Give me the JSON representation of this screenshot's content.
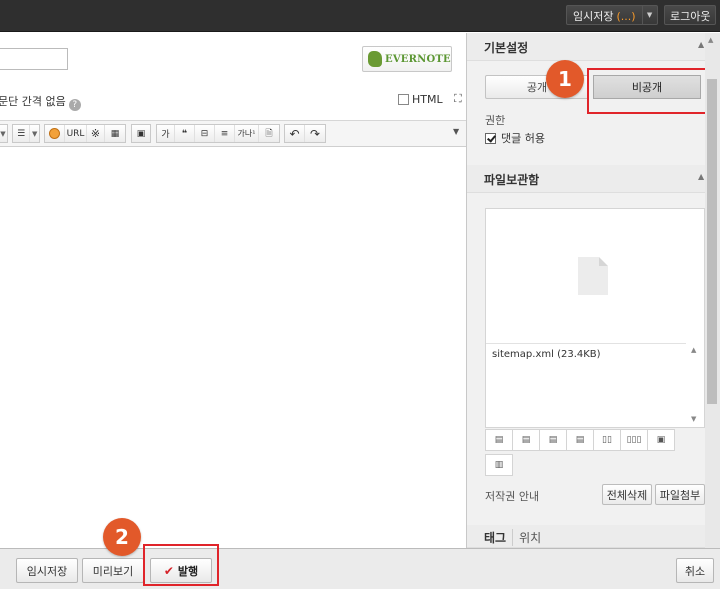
{
  "header": {
    "temp_save_label": "임시저장",
    "temp_save_count": "(...)",
    "logout_label": "로그아웃"
  },
  "editor": {
    "evernote_label": "EVERNOTE",
    "paragraph_option": "문단 간격 없음",
    "html_label": "HTML"
  },
  "toolbar": {
    "url_label": "URL",
    "quote_label": "❝",
    "ga_label": "가",
    "ga1_label": "가나¹"
  },
  "sidebar": {
    "basic_settings": {
      "title": "기본설정",
      "public_label": "공개",
      "private_label": "비공개",
      "permission_label": "권한",
      "allow_comments_label": "댓글 허용"
    },
    "file_storage": {
      "title": "파일보관함",
      "files": [
        "sitemap.xml (23.4KB)"
      ],
      "copyright_label": "저작권 안내",
      "delete_all_label": "전체삭제",
      "attach_label": "파일첨부"
    },
    "tags": {
      "tag_label": "태그",
      "location_label": "위치"
    }
  },
  "markers": {
    "one": "1",
    "two": "2"
  },
  "footer": {
    "temp_save_label": "임시저장",
    "preview_label": "미리보기",
    "publish_label": "발행",
    "cancel_label": "취소"
  },
  "colors": {
    "marker": "#e2592a",
    "highlight": "#e0242a",
    "evernote_green": "#5b9632",
    "topbar": "#2f2f2f"
  }
}
